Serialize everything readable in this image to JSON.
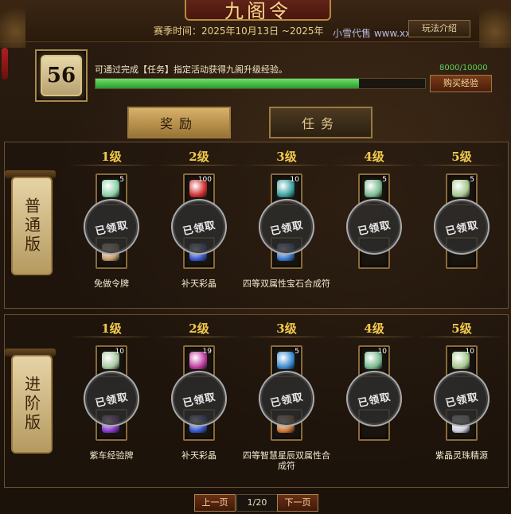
{
  "window": {
    "title": "九阁令"
  },
  "header": {
    "season": "赛季时间：2025年10月13日 ~2025年",
    "watermark": "小雪代售 www.xxds",
    "rules_button": "玩法介绍"
  },
  "progress": {
    "level": "56",
    "description": "可通过完成【任务】指定活动获得九阁升级经验。",
    "exp_text": "8000/10000",
    "fraction": 0.8,
    "buy_button": "购买经验"
  },
  "tabs": [
    {
      "label": "奖励",
      "active": true
    },
    {
      "label": "任务",
      "active": false
    }
  ],
  "tracks": [
    {
      "label": "普通版",
      "rewards": [
        {
          "level": "1级",
          "qty_top": "5",
          "name": "免做令牌",
          "claimed": "已领取",
          "top_color": "#8ad0a8",
          "bottom_color": "#c8a070"
        },
        {
          "level": "2级",
          "qty_top": "100",
          "name": "补天彩晶",
          "claimed": "已领取",
          "top_color": "#d03030",
          "bottom_color": "#3a5ad0"
        },
        {
          "level": "3级",
          "qty_top": "10",
          "name": "四等双属性宝石合成符",
          "claimed": "已领取",
          "top_color": "#3aa0a0",
          "bottom_color": "#3a7ad0"
        },
        {
          "level": "4级",
          "qty_top": "5",
          "name": "",
          "claimed": "已领取",
          "top_color": "#7ab890",
          "bottom_color": ""
        },
        {
          "level": "5级",
          "qty_top": "5",
          "name": "",
          "claimed": "已领取",
          "top_color": "#a8c890",
          "bottom_color": ""
        }
      ]
    },
    {
      "label": "进阶版",
      "rewards": [
        {
          "level": "1级",
          "qty_top": "10",
          "name": "紫车经验牌",
          "claimed": "已领取",
          "top_color": "#a8c8a0",
          "bottom_color": "#8a3ad0"
        },
        {
          "level": "2级",
          "qty_top": "19",
          "name": "补天彩晶",
          "claimed": "已领取",
          "top_color": "#c03aa0",
          "bottom_color": "#3a5ad0"
        },
        {
          "level": "3级",
          "qty_top": "5",
          "name": "四等智慧星辰双属性合成符",
          "claimed": "已领取",
          "top_color": "#3a8ad0",
          "bottom_color": "#d07a3a"
        },
        {
          "level": "4级",
          "qty_top": "10",
          "name": "",
          "claimed": "已领取",
          "top_color": "#7ab890",
          "bottom_color": ""
        },
        {
          "level": "5级",
          "qty_top": "10",
          "name": "紫晶灵珠精源",
          "claimed": "已领取",
          "top_color": "#a8c890",
          "bottom_color": "#d0d0e0"
        }
      ]
    }
  ],
  "pager": {
    "prev": "上一页",
    "page": "1/20",
    "next": "下一页"
  }
}
